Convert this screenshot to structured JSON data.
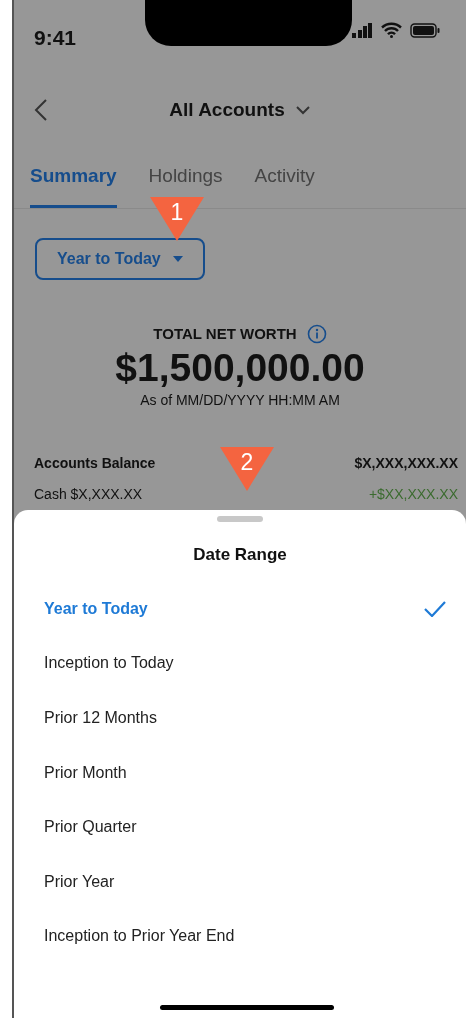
{
  "status_bar": {
    "time": "9:41"
  },
  "header": {
    "title": "All Accounts"
  },
  "tabs": [
    {
      "label": "Summary",
      "selected": true
    },
    {
      "label": "Holdings",
      "selected": false
    },
    {
      "label": "Activity",
      "selected": false
    }
  ],
  "date_filter": {
    "label": "Year to Today"
  },
  "net_worth": {
    "label": "TOTAL NET WORTH",
    "amount": "$1,500,000.00",
    "as_of": "As of MM/DD/YYYY HH:MM AM"
  },
  "balances": [
    {
      "label": "Accounts Balance",
      "value": "$X,XXX,XXX.XX"
    },
    {
      "label": "Cash $X,XXX.XX",
      "value": "+$XX,XXX.XX"
    }
  ],
  "sheet": {
    "title": "Date Range",
    "options": [
      {
        "label": "Year to Today",
        "selected": true
      },
      {
        "label": "Inception to Today",
        "selected": false
      },
      {
        "label": "Prior 12 Months",
        "selected": false
      },
      {
        "label": "Prior Month",
        "selected": false
      },
      {
        "label": "Prior Quarter",
        "selected": false
      },
      {
        "label": "Prior Year",
        "selected": false
      },
      {
        "label": "Inception to Prior Year End",
        "selected": false
      }
    ]
  },
  "callouts": [
    {
      "label": "1"
    },
    {
      "label": "2"
    }
  ]
}
